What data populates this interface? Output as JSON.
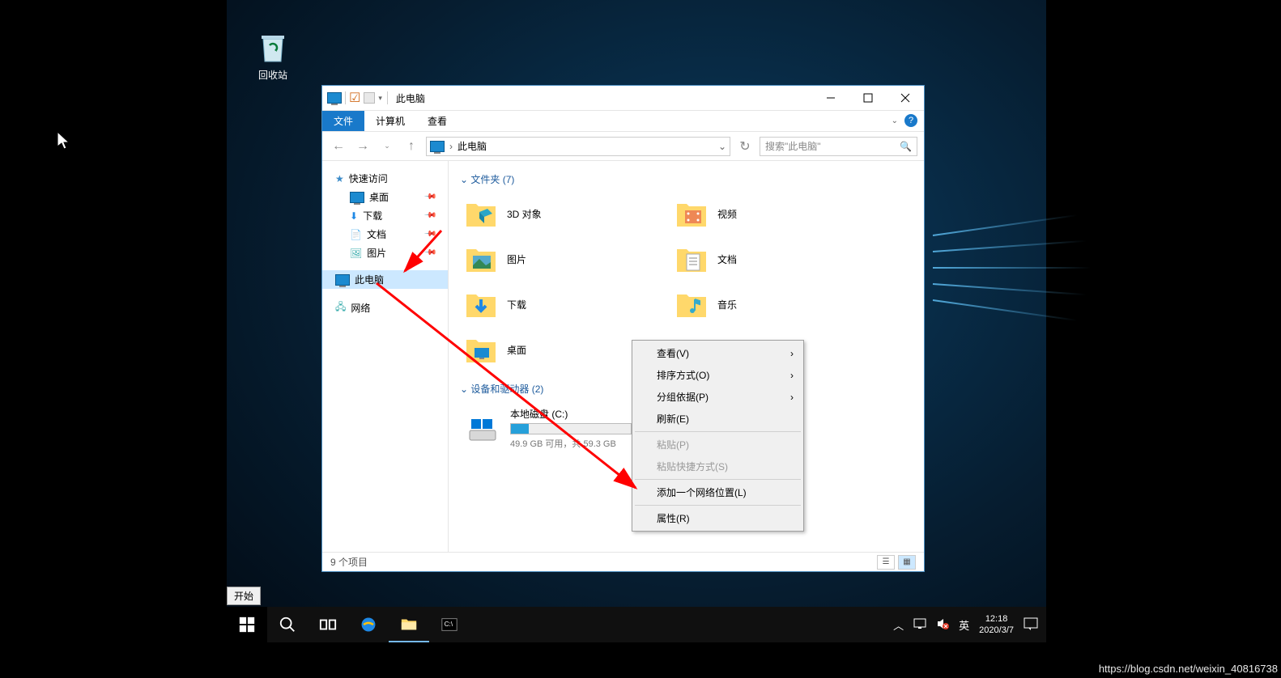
{
  "desktop": {
    "recycle_bin": "回收站",
    "start_tooltip": "开始"
  },
  "explorer": {
    "title": "此电脑",
    "tabs": {
      "file": "文件",
      "computer": "计算机",
      "view": "查看"
    },
    "breadcrumb": "此电脑",
    "search_placeholder": "搜索\"此电脑\"",
    "sidebar": {
      "quick_access": "快速访问",
      "desktop": "桌面",
      "downloads": "下载",
      "documents": "文档",
      "pictures": "图片",
      "this_pc": "此电脑",
      "network": "网络"
    },
    "sections": {
      "folders": "文件夹 (7)",
      "drives": "设备和驱动器 (2)"
    },
    "folders": [
      {
        "name": "3D 对象"
      },
      {
        "name": "视频"
      },
      {
        "name": "图片"
      },
      {
        "name": "文档"
      },
      {
        "name": "下载"
      },
      {
        "name": "音乐"
      },
      {
        "name": "桌面"
      }
    ],
    "drive": {
      "name": "本地磁盘 (C:)",
      "detail": "49.9 GB 可用，共 59.3 GB"
    },
    "status": "9 个项目"
  },
  "context_menu": {
    "view": "查看(V)",
    "sort": "排序方式(O)",
    "group": "分组依据(P)",
    "refresh": "刷新(E)",
    "paste": "粘贴(P)",
    "paste_shortcut": "粘贴快捷方式(S)",
    "add_network": "添加一个网络位置(L)",
    "properties": "属性(R)"
  },
  "taskbar": {
    "ime": "英",
    "time": "12:18",
    "date": "2020/3/7"
  },
  "watermark": "https://blog.csdn.net/weixin_40816738"
}
